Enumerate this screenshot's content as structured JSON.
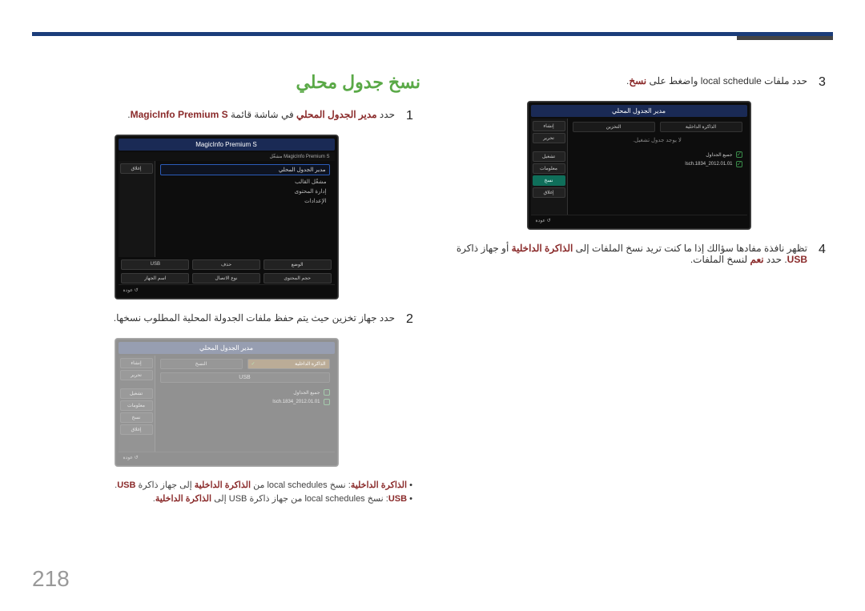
{
  "page_number": "218",
  "section_title": "نسخ جدول محلي",
  "right_col": {
    "step1": {
      "num": "1",
      "prefix": "حدد ",
      "maroon1": "مدير الجدول المحلي",
      "middle": " في شاشة قائمة ",
      "maroon2": "MagicInfo Premium S",
      "suffix": "."
    },
    "window1": {
      "title": "MagicInfo Premium S",
      "subhead": "MagicInfo Premium S مشغّل",
      "sidebar_tag": "إغلاق",
      "highlight": "مدير الجدول المحلي",
      "lines": [
        "مشغّل القالب",
        "إدارة المحتوى",
        "الإعدادات"
      ],
      "bottom": [
        "الوضع",
        "حذف",
        "USB"
      ],
      "bottom2": [
        "حجم المحتوى",
        "نوع الاتصال",
        "اسم الجهاز"
      ],
      "return": "عودة"
    },
    "step2": {
      "num": "2",
      "text": "حدد جهاز تخزين حيث يتم حفظ ملفات الجدولة المحلية المطلوب نسخها."
    },
    "window2": {
      "title": "مدير الجدول المحلي",
      "col_right_head": "الذاكرة الداخلية",
      "col_check": "✓",
      "col_left_head": "النسخ",
      "row_usb": "USB",
      "sidebar": [
        "إنشاء",
        "تحرير",
        "",
        "تشغيل",
        "معلومات",
        "نسخ",
        "إغلاق"
      ],
      "file_all": "جميع الجداول",
      "file1": "2012.01.01_1834.lsch",
      "return": "عودة"
    },
    "bullet1_prefix": "الذاكرة الداخلية",
    "bullet1_middle": ": نسخ local schedules من ",
    "bullet1_maroon": "الذاكرة الداخلية",
    "bullet1_suffix": " إلى جهاز ذاكرة ",
    "bullet1_usb": "USB",
    "bullet2_prefix": "USB",
    "bullet2_middle": ": نسخ local schedules من جهاز ذاكرة USB إلى ",
    "bullet2_maroon": "الذاكرة الداخلية",
    "bullet2_suffix": "."
  },
  "left_col": {
    "step3": {
      "num": "3",
      "pre": "حدد ملفات local schedule واضغط على ",
      "maroon": "نسخ",
      "suffix": "."
    },
    "window3": {
      "title": "مدير الجدول المحلي",
      "col_right_head": "الذاكرة الداخلية",
      "col_left_head": "التخزين",
      "sidebar": [
        "إنشاء",
        "تحرير",
        "",
        "تشغيل",
        "معلومات",
        "نسخ",
        "إغلاق"
      ],
      "sidebar_green_index": 5,
      "no_table": "لا يوجد جدول تشغيل.",
      "file_all": "جميع الجداول",
      "file1": "2012.01.01_1834.lsch",
      "return": "عودة"
    },
    "step4": {
      "num": "4",
      "pre": "تظهر نافذة مفادها سؤالك إذا ما كنت تريد نسخ الملفات إلى ",
      "maroon1": "الذاكرة الداخلية",
      "mid": " أو جهاز ذاكرة ",
      "maroon2": "USB",
      "post": ". حدد ",
      "maroon3": "نعم",
      "suffix": " لنسخ الملفات."
    }
  }
}
